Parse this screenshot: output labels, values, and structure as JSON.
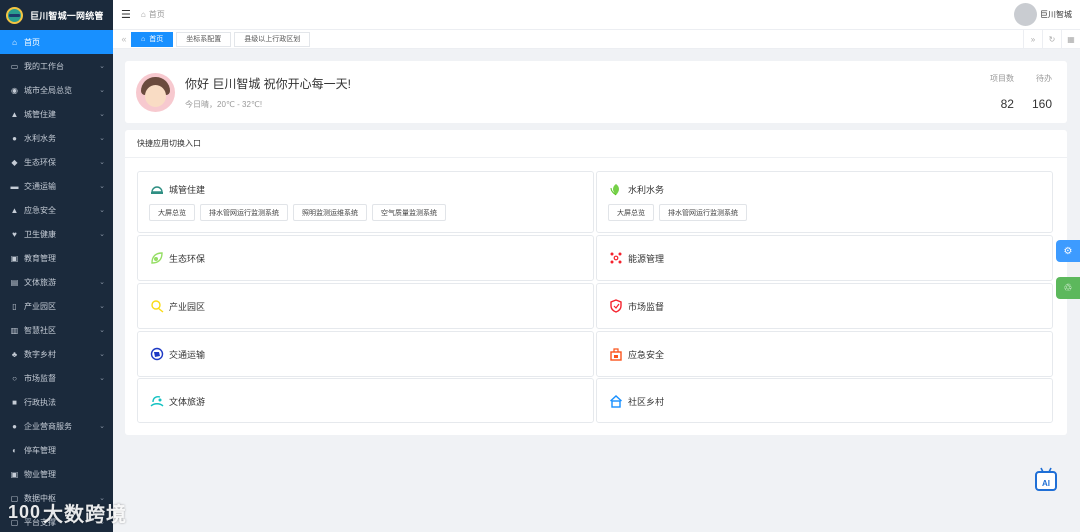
{
  "app": {
    "title": "巨川智城一网统管"
  },
  "sidebar": {
    "items": [
      {
        "label": "首页",
        "icon": "⌂",
        "has_caret": false,
        "active": true
      },
      {
        "label": "我的工作台",
        "icon": "▭",
        "has_caret": true
      },
      {
        "label": "城市全局总览",
        "icon": "◉",
        "has_caret": true
      },
      {
        "label": "城管住建",
        "icon": "▲",
        "has_caret": true
      },
      {
        "label": "水利水务",
        "icon": "●",
        "has_caret": true
      },
      {
        "label": "生态环保",
        "icon": "◆",
        "has_caret": true
      },
      {
        "label": "交通运输",
        "icon": "▬",
        "has_caret": true
      },
      {
        "label": "应急安全",
        "icon": "▲",
        "has_caret": true
      },
      {
        "label": "卫生健康",
        "icon": "♥",
        "has_caret": true
      },
      {
        "label": "教育管理",
        "icon": "▣",
        "has_caret": false
      },
      {
        "label": "文体旅游",
        "icon": "▤",
        "has_caret": true
      },
      {
        "label": "产业园区",
        "icon": "▯",
        "has_caret": true
      },
      {
        "label": "智慧社区",
        "icon": "▥",
        "has_caret": true
      },
      {
        "label": "数字乡村",
        "icon": "♣",
        "has_caret": true
      },
      {
        "label": "市场监督",
        "icon": "○",
        "has_caret": true
      },
      {
        "label": "行政执法",
        "icon": "■",
        "has_caret": false
      },
      {
        "label": "企业营商服务",
        "icon": "●",
        "has_caret": true
      },
      {
        "label": "停车管理",
        "icon": "◐",
        "has_caret": false
      },
      {
        "label": "物业管理",
        "icon": "▣",
        "has_caret": false
      },
      {
        "label": "数据中枢",
        "icon": "▢",
        "has_caret": true
      },
      {
        "label": "平台支撑",
        "icon": "▢",
        "has_caret": true
      }
    ]
  },
  "header": {
    "breadcrumb": "首页",
    "user_name": "巨川智城"
  },
  "tabs": [
    {
      "label": "首页",
      "active": true
    },
    {
      "label": "坐标系配置",
      "active": false
    },
    {
      "label": "县级以上行政区划",
      "active": false
    }
  ],
  "welcome": {
    "greeting": "你好 巨川智城 祝你开心每一天!",
    "weather": "今日晴，20℃ - 32℃!",
    "stats": [
      {
        "label": "项目数",
        "value": "82"
      },
      {
        "label": "待办",
        "value": "160"
      }
    ]
  },
  "quick_access": {
    "title": "快捷应用切换入口",
    "cells": [
      {
        "title": "城管住建",
        "icon": "helmet-icon",
        "color": "#2f8f83",
        "buttons": [
          "大屏总览",
          "排水管网运行监测系统",
          "照明监测运维系统",
          "空气质量监测系统"
        ]
      },
      {
        "title": "水利水务",
        "icon": "water-plant-icon",
        "color": "#52c41a",
        "buttons": [
          "大屏总览",
          "排水管网运行监测系统"
        ]
      },
      {
        "title": "生态环保",
        "icon": "leaf-icon",
        "color": "#95de64",
        "buttons": []
      },
      {
        "title": "能源管理",
        "icon": "energy-network-icon",
        "color": "#f5222d",
        "buttons": []
      },
      {
        "title": "产业园区",
        "icon": "park-icon",
        "color": "#fadb14",
        "buttons": []
      },
      {
        "title": "市场监督",
        "icon": "shield-icon",
        "color": "#f5222d",
        "buttons": []
      },
      {
        "title": "交通运输",
        "icon": "traffic-globe-icon",
        "color": "#1d39c4",
        "buttons": []
      },
      {
        "title": "应急安全",
        "icon": "emergency-building-icon",
        "color": "#fa541c",
        "buttons": []
      },
      {
        "title": "文体旅游",
        "icon": "travel-icon",
        "color": "#13c2c2",
        "buttons": []
      },
      {
        "title": "社区乡村",
        "icon": "house-icon",
        "color": "#1890ff",
        "buttons": []
      }
    ]
  },
  "ai_assistant": {
    "label": "AI"
  },
  "watermark": {
    "mark": "100",
    "text": "大数跨境"
  }
}
